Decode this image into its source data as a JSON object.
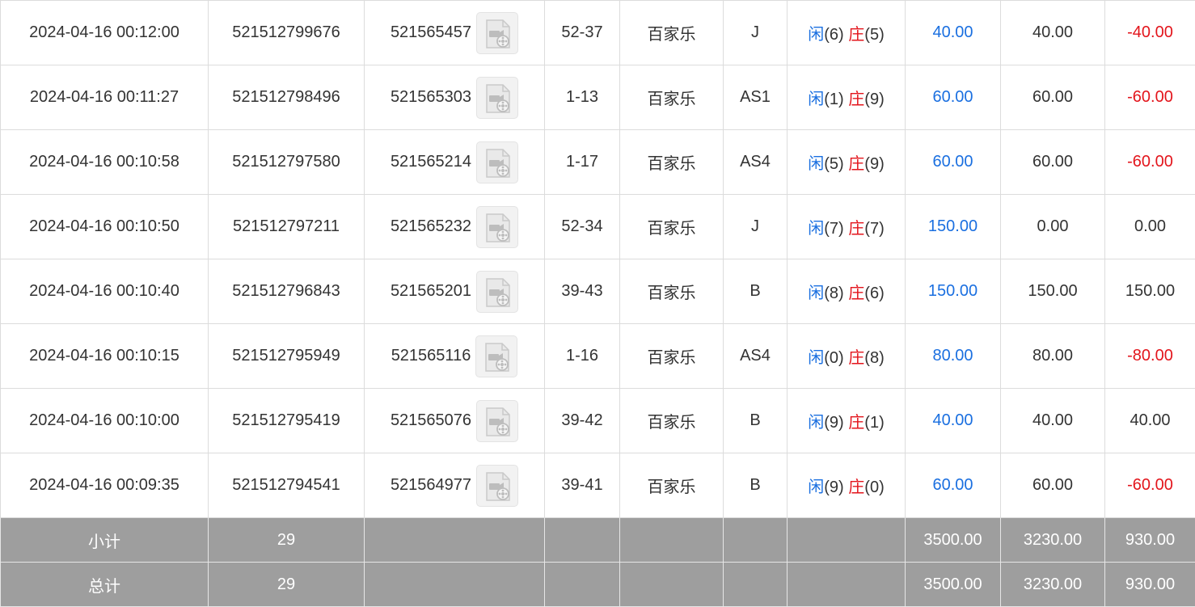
{
  "colors": {
    "player": "#1a6fe0",
    "banker": "#e3151c",
    "bet": "#1a6fe0",
    "negative": "#e3151c",
    "summary_bg": "#9e9e9e"
  },
  "rows": [
    {
      "time": "2024-04-16 00:12:00",
      "bet_no": "521512799676",
      "game_no": "521565457",
      "table": "52-37",
      "game": "百家乐",
      "play": "J",
      "player_label": "闲",
      "player_pts": "(6)",
      "banker_label": "庄",
      "banker_pts": "(5)",
      "bet": "40.00",
      "valid": "40.00",
      "win": "-40.00",
      "neg": true
    },
    {
      "time": "2024-04-16 00:11:27",
      "bet_no": "521512798496",
      "game_no": "521565303",
      "table": "1-13",
      "game": "百家乐",
      "play": "AS1",
      "player_label": "闲",
      "player_pts": "(1)",
      "banker_label": "庄",
      "banker_pts": "(9)",
      "bet": "60.00",
      "valid": "60.00",
      "win": "-60.00",
      "neg": true
    },
    {
      "time": "2024-04-16 00:10:58",
      "bet_no": "521512797580",
      "game_no": "521565214",
      "table": "1-17",
      "game": "百家乐",
      "play": "AS4",
      "player_label": "闲",
      "player_pts": "(5)",
      "banker_label": "庄",
      "banker_pts": "(9)",
      "bet": "60.00",
      "valid": "60.00",
      "win": "-60.00",
      "neg": true
    },
    {
      "time": "2024-04-16 00:10:50",
      "bet_no": "521512797211",
      "game_no": "521565232",
      "table": "52-34",
      "game": "百家乐",
      "play": "J",
      "player_label": "闲",
      "player_pts": "(7)",
      "banker_label": "庄",
      "banker_pts": "(7)",
      "bet": "150.00",
      "valid": "0.00",
      "win": "0.00",
      "neg": false
    },
    {
      "time": "2024-04-16 00:10:40",
      "bet_no": "521512796843",
      "game_no": "521565201",
      "table": "39-43",
      "game": "百家乐",
      "play": "B",
      "player_label": "闲",
      "player_pts": "(8)",
      "banker_label": "庄",
      "banker_pts": "(6)",
      "bet": "150.00",
      "valid": "150.00",
      "win": "150.00",
      "neg": false
    },
    {
      "time": "2024-04-16 00:10:15",
      "bet_no": "521512795949",
      "game_no": "521565116",
      "table": "1-16",
      "game": "百家乐",
      "play": "AS4",
      "player_label": "闲",
      "player_pts": "(0)",
      "banker_label": "庄",
      "banker_pts": "(8)",
      "bet": "80.00",
      "valid": "80.00",
      "win": "-80.00",
      "neg": true
    },
    {
      "time": "2024-04-16 00:10:00",
      "bet_no": "521512795419",
      "game_no": "521565076",
      "table": "39-42",
      "game": "百家乐",
      "play": "B",
      "player_label": "闲",
      "player_pts": "(9)",
      "banker_label": "庄",
      "banker_pts": "(1)",
      "bet": "40.00",
      "valid": "40.00",
      "win": "40.00",
      "neg": false
    },
    {
      "time": "2024-04-16 00:09:35",
      "bet_no": "521512794541",
      "game_no": "521564977",
      "table": "39-41",
      "game": "百家乐",
      "play": "B",
      "player_label": "闲",
      "player_pts": "(9)",
      "banker_label": "庄",
      "banker_pts": "(0)",
      "bet": "60.00",
      "valid": "60.00",
      "win": "-60.00",
      "neg": true
    }
  ],
  "summary": [
    {
      "label": "小计",
      "count": "29",
      "bet": "3500.00",
      "valid": "3230.00",
      "win": "930.00"
    },
    {
      "label": "总计",
      "count": "29",
      "bet": "3500.00",
      "valid": "3230.00",
      "win": "930.00"
    }
  ]
}
